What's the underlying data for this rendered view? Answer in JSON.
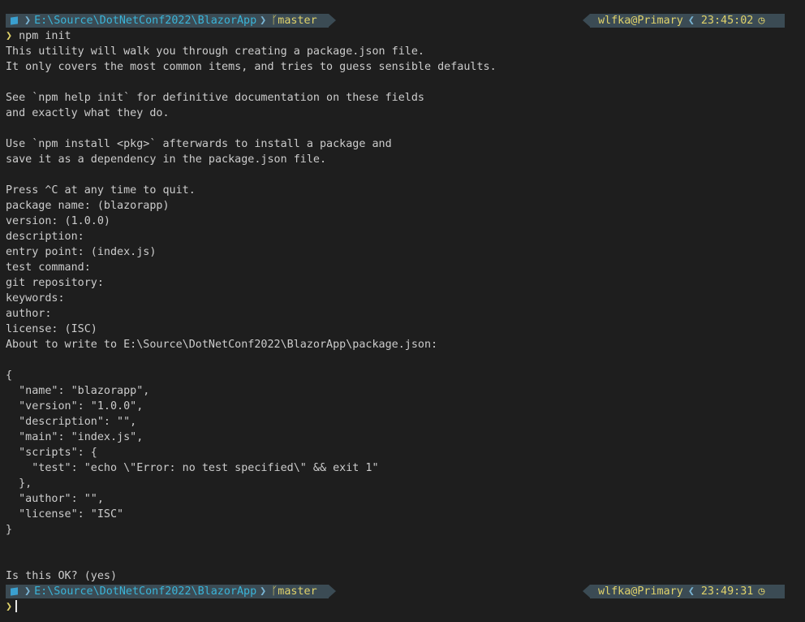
{
  "prompt1": {
    "os_icon": "windows-icon",
    "path": "E:\\Source\\DotNetConf2022\\BlazorApp",
    "branch_icon": "git-branch-icon",
    "branch": "master",
    "user": "wlfka@Primary",
    "time": "23:45:02",
    "clock_icon": "clock-icon"
  },
  "command": {
    "arrow": "❯",
    "text": "npm init"
  },
  "output": [
    "This utility will walk you through creating a package.json file.",
    "It only covers the most common items, and tries to guess sensible defaults.",
    "",
    "See `npm help init` for definitive documentation on these fields",
    "and exactly what they do.",
    "",
    "Use `npm install <pkg>` afterwards to install a package and",
    "save it as a dependency in the package.json file.",
    "",
    "Press ^C at any time to quit.",
    "package name: (blazorapp)",
    "version: (1.0.0)",
    "description:",
    "entry point: (index.js)",
    "test command:",
    "git repository:",
    "keywords:",
    "author:",
    "license: (ISC)",
    "About to write to E:\\Source\\DotNetConf2022\\BlazorApp\\package.json:",
    "",
    "{",
    "  \"name\": \"blazorapp\",",
    "  \"version\": \"1.0.0\",",
    "  \"description\": \"\",",
    "  \"main\": \"index.js\",",
    "  \"scripts\": {",
    "    \"test\": \"echo \\\"Error: no test specified\\\" && exit 1\"",
    "  },",
    "  \"author\": \"\",",
    "  \"license\": \"ISC\"",
    "}",
    "",
    "",
    "Is this OK? (yes)"
  ],
  "prompt2": {
    "os_icon": "windows-icon",
    "path": "E:\\Source\\DotNetConf2022\\BlazorApp",
    "branch_icon": "git-branch-icon",
    "branch": "master",
    "user": "wlfka@Primary",
    "time": "23:49:31",
    "clock_icon": "clock-icon"
  },
  "final_prompt": {
    "arrow": "❯",
    "text": ""
  }
}
